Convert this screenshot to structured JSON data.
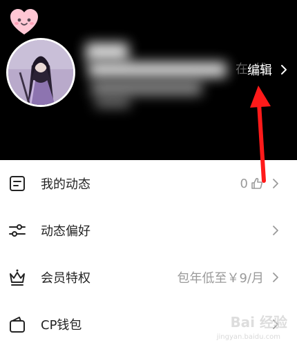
{
  "header": {
    "status_text": "在 线",
    "edit_label": "编辑"
  },
  "menu": {
    "items": [
      {
        "name": "my-posts",
        "label": "我的动态",
        "value": "0",
        "icon": "document-icon"
      },
      {
        "name": "post-preferences",
        "label": "动态偏好",
        "value": "",
        "icon": "sliders-icon"
      },
      {
        "name": "membership-privileges",
        "label": "会员特权",
        "value": "包年低至￥9/月",
        "icon": "crown-icon"
      },
      {
        "name": "cp-wallet",
        "label": "CP钱包",
        "value": "",
        "icon": "wallet-icon"
      }
    ]
  },
  "colors": {
    "header_bg": "#000000",
    "annotation_arrow": "#ff1a1a",
    "heart_logo": "#ffc7d4"
  },
  "watermark": {
    "text": "Bai 经验",
    "sub": "jingyan.baidu.com"
  }
}
